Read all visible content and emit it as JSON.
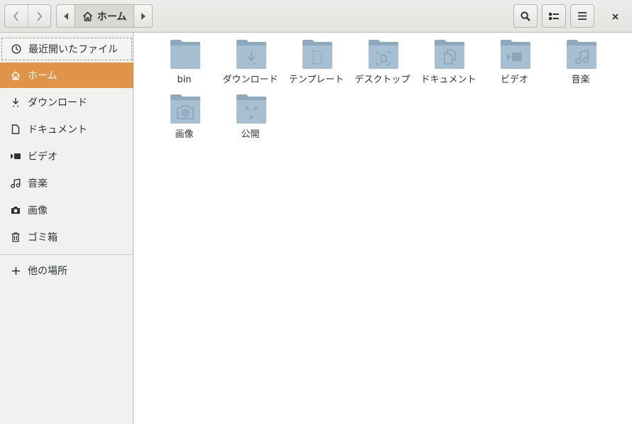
{
  "header": {
    "back_icon": "chevron-left-icon",
    "forward_icon": "chevron-right-icon",
    "path": {
      "label": "ホーム",
      "icon": "home-icon"
    },
    "tools": [
      "search-icon",
      "view-list-icon",
      "menu-icon"
    ],
    "close_icon": "close-icon"
  },
  "sidebar": {
    "items": [
      {
        "label": "最近開いたファイル",
        "icon": "clock-icon"
      },
      {
        "label": "ホーム",
        "icon": "home-icon",
        "active": true
      },
      {
        "label": "ダウンロード",
        "icon": "download-icon"
      },
      {
        "label": "ドキュメント",
        "icon": "document-icon"
      },
      {
        "label": "ビデオ",
        "icon": "video-icon"
      },
      {
        "label": "音楽",
        "icon": "music-icon"
      },
      {
        "label": "画像",
        "icon": "camera-icon"
      },
      {
        "label": "ゴミ箱",
        "icon": "trash-icon"
      }
    ],
    "other_places": {
      "label": "他の場所",
      "icon": "plus-icon"
    }
  },
  "files": [
    {
      "name": "bin",
      "icon": "folder-icon"
    },
    {
      "name": "ダウンロード",
      "icon": "folder-download-icon"
    },
    {
      "name": "テンプレート",
      "icon": "folder-templates-icon"
    },
    {
      "name": "デスクトップ",
      "icon": "folder-desktop-icon"
    },
    {
      "name": "ドキュメント",
      "icon": "folder-documents-icon"
    },
    {
      "name": "ビデオ",
      "icon": "folder-videos-icon"
    },
    {
      "name": "音楽",
      "icon": "folder-music-icon"
    },
    {
      "name": "画像",
      "icon": "folder-pictures-icon"
    },
    {
      "name": "公開",
      "icon": "folder-publicshare-icon"
    }
  ],
  "colors": {
    "accent": "#e0944a",
    "folder": "#a6bfd2",
    "folder_dark": "#8ea9be"
  }
}
